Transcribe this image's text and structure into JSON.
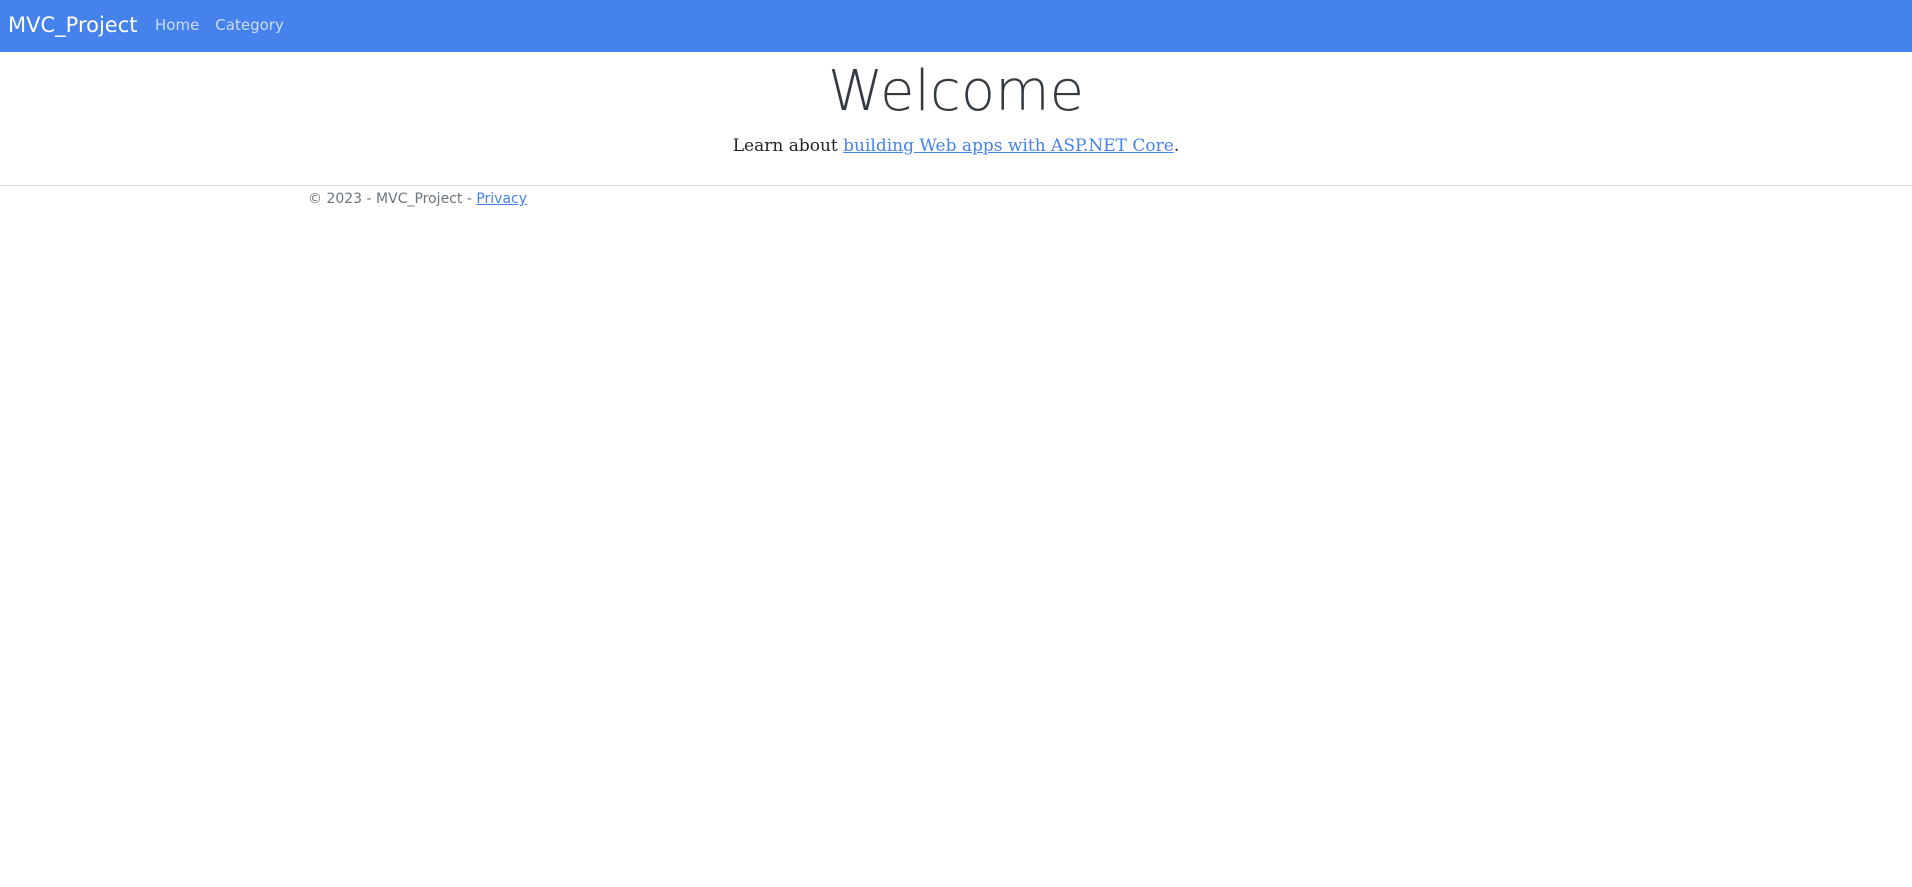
{
  "navbar": {
    "brand": "MVC_Project",
    "links": [
      {
        "label": "Home"
      },
      {
        "label": "Category"
      }
    ],
    "color": "#4582ec"
  },
  "main": {
    "title": "Welcome",
    "lead_prefix": "Learn about ",
    "lead_link": "building Web apps with ASP.NET Core",
    "lead_suffix": "."
  },
  "footer": {
    "text": "© 2023 - MVC_Project - ",
    "privacy_link": "Privacy"
  }
}
